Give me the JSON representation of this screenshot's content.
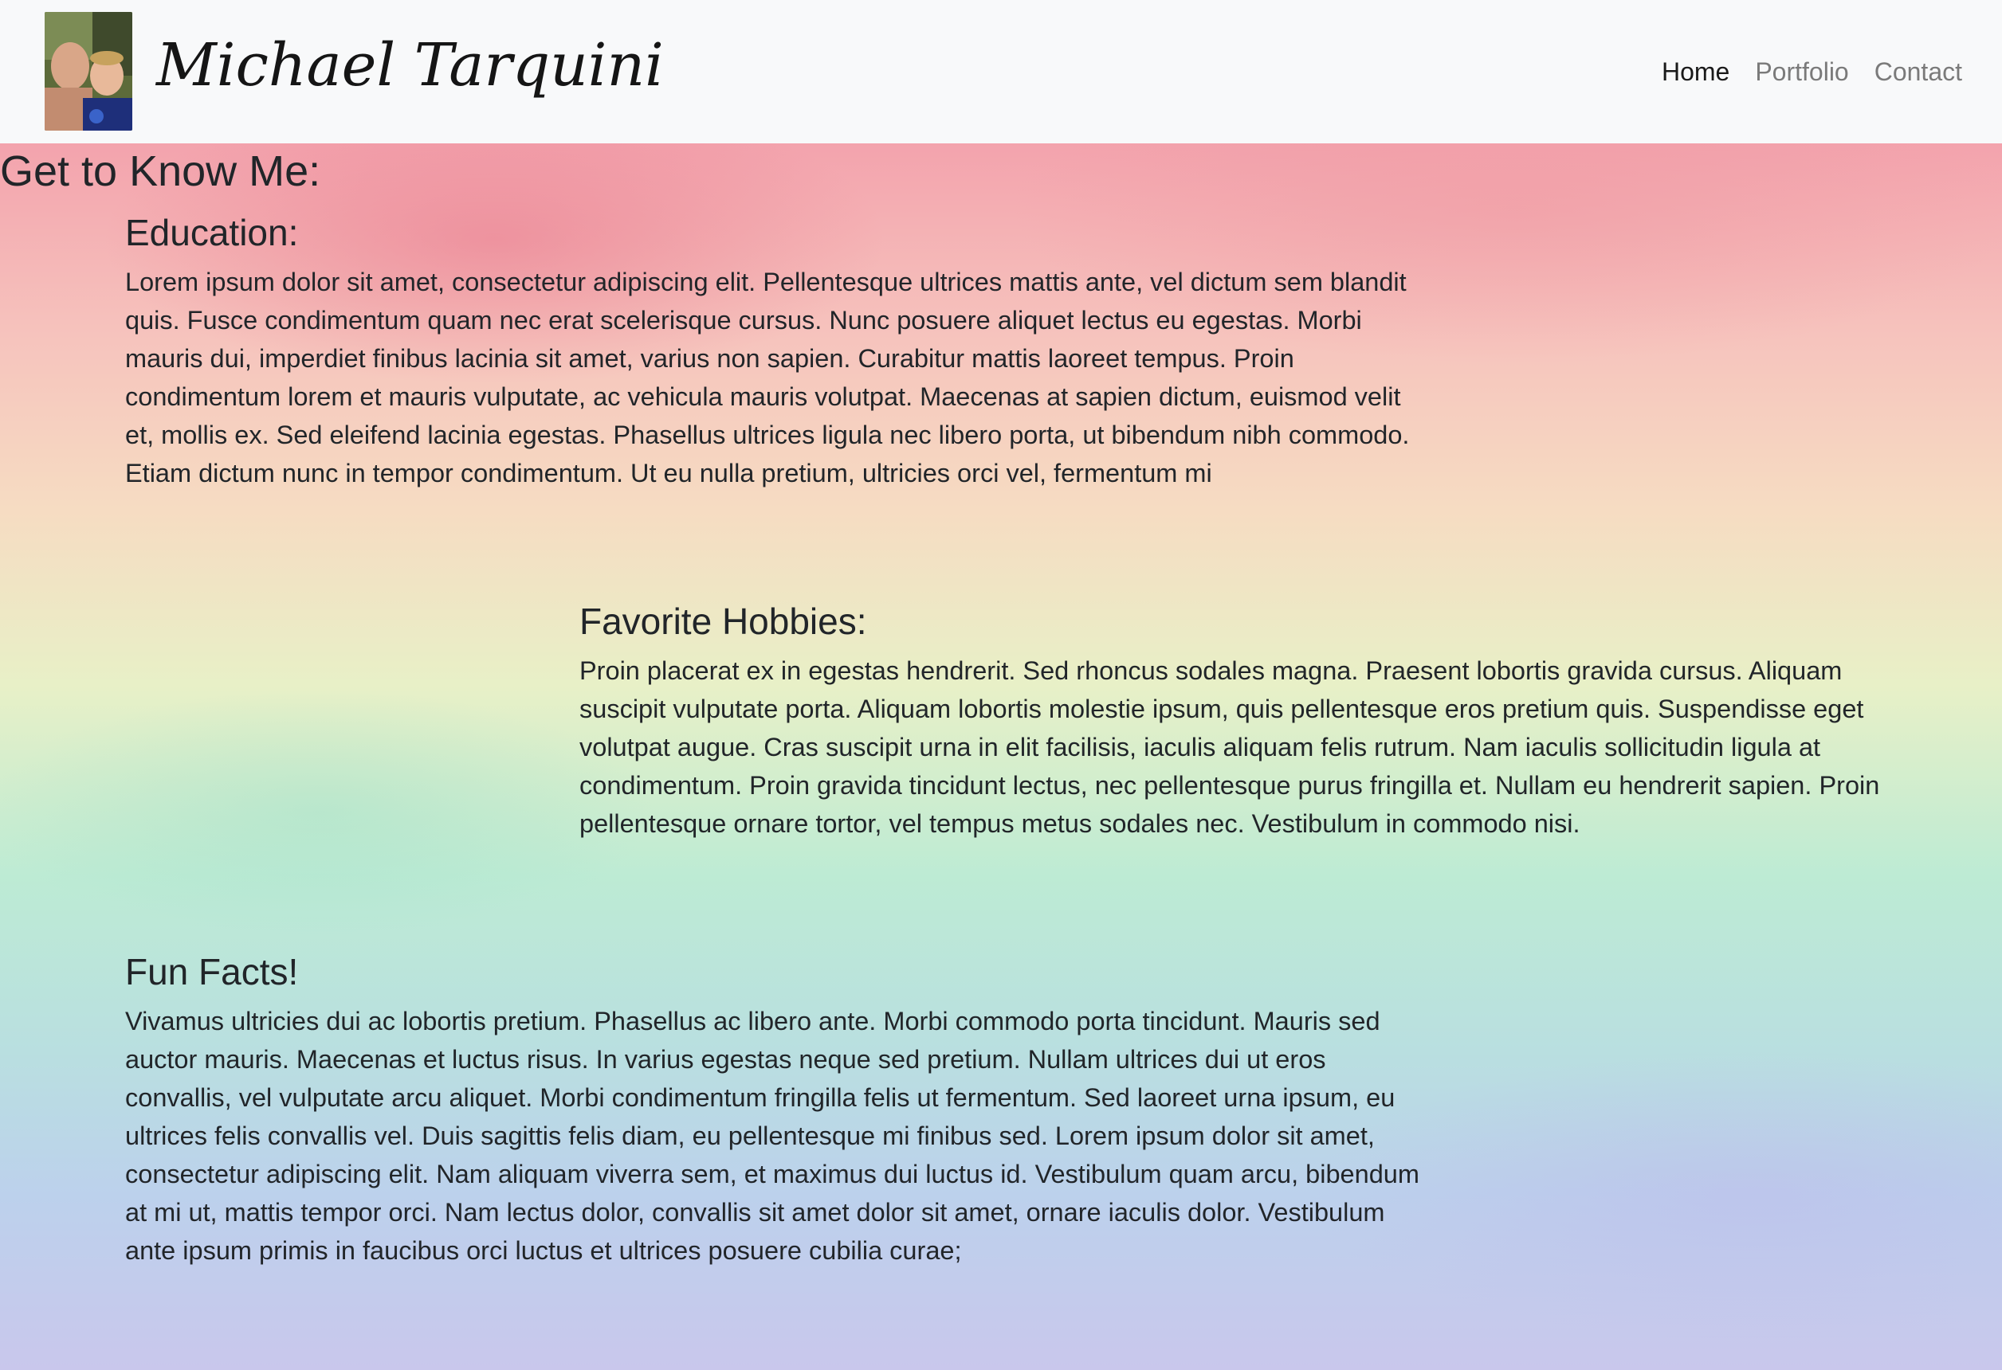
{
  "header": {
    "brand_name": "Michael Tarquini",
    "avatar_alt": "Profile photo of Michael Tarquini with a child",
    "nav": [
      {
        "label": "Home",
        "active": true
      },
      {
        "label": "Portfolio",
        "active": false
      },
      {
        "label": "Contact",
        "active": false
      }
    ]
  },
  "main": {
    "heading": "Get to Know Me:",
    "sections": [
      {
        "title": "Education:",
        "body": "Lorem ipsum dolor sit amet, consectetur adipiscing elit. Pellentesque ultrices mattis ante, vel dictum sem blandit quis. Fusce condimentum quam nec erat scelerisque cursus. Nunc posuere aliquet lectus eu egestas. Morbi mauris dui, imperdiet finibus lacinia sit amet, varius non sapien. Curabitur mattis laoreet tempus. Proin condimentum lorem et mauris vulputate, ac vehicula mauris volutpat. Maecenas at sapien dictum, euismod velit et, mollis ex. Sed eleifend lacinia egestas. Phasellus ultrices ligula nec libero porta, ut bibendum nibh commodo. Etiam dictum nunc in tempor condimentum. Ut eu nulla pretium, ultricies orci vel, fermentum mi"
      },
      {
        "title": "Favorite Hobbies:",
        "body": "Proin placerat ex in egestas hendrerit. Sed rhoncus sodales magna. Praesent lobortis gravida cursus. Aliquam suscipit vulputate porta. Aliquam lobortis molestie ipsum, quis pellentesque eros pretium quis. Suspendisse eget volutpat augue. Cras suscipit urna in elit facilisis, iaculis aliquam felis rutrum. Nam iaculis sollicitudin ligula at condimentum. Proin gravida tincidunt lectus, nec pellentesque purus fringilla et. Nullam eu hendrerit sapien. Proin pellentesque ornare tortor, vel tempus metus sodales nec. Vestibulum in commodo nisi."
      },
      {
        "title": "Fun Facts!",
        "body": "Vivamus ultricies dui ac lobortis pretium. Phasellus ac libero ante. Morbi commodo porta tincidunt. Mauris sed auctor mauris. Maecenas et luctus risus. In varius egestas neque sed pretium. Nullam ultrices dui ut eros convallis, vel vulputate arcu aliquet. Morbi condimentum fringilla felis ut fermentum. Sed laoreet urna ipsum, eu ultrices felis convallis vel. Duis sagittis felis diam, eu pellentesque mi finibus sed. Lorem ipsum dolor sit amet, consectetur adipiscing elit. Nam aliquam viverra sem, et maximus dui luctus id. Vestibulum quam arcu, bibendum at mi ut, mattis tempor orci. Nam lectus dolor, convallis sit amet dolor sit amet, ornare iaculis dolor. Vestibulum ante ipsum primis in faucibus orci luctus et ultrices posuere cubilia curae;"
      }
    ]
  }
}
